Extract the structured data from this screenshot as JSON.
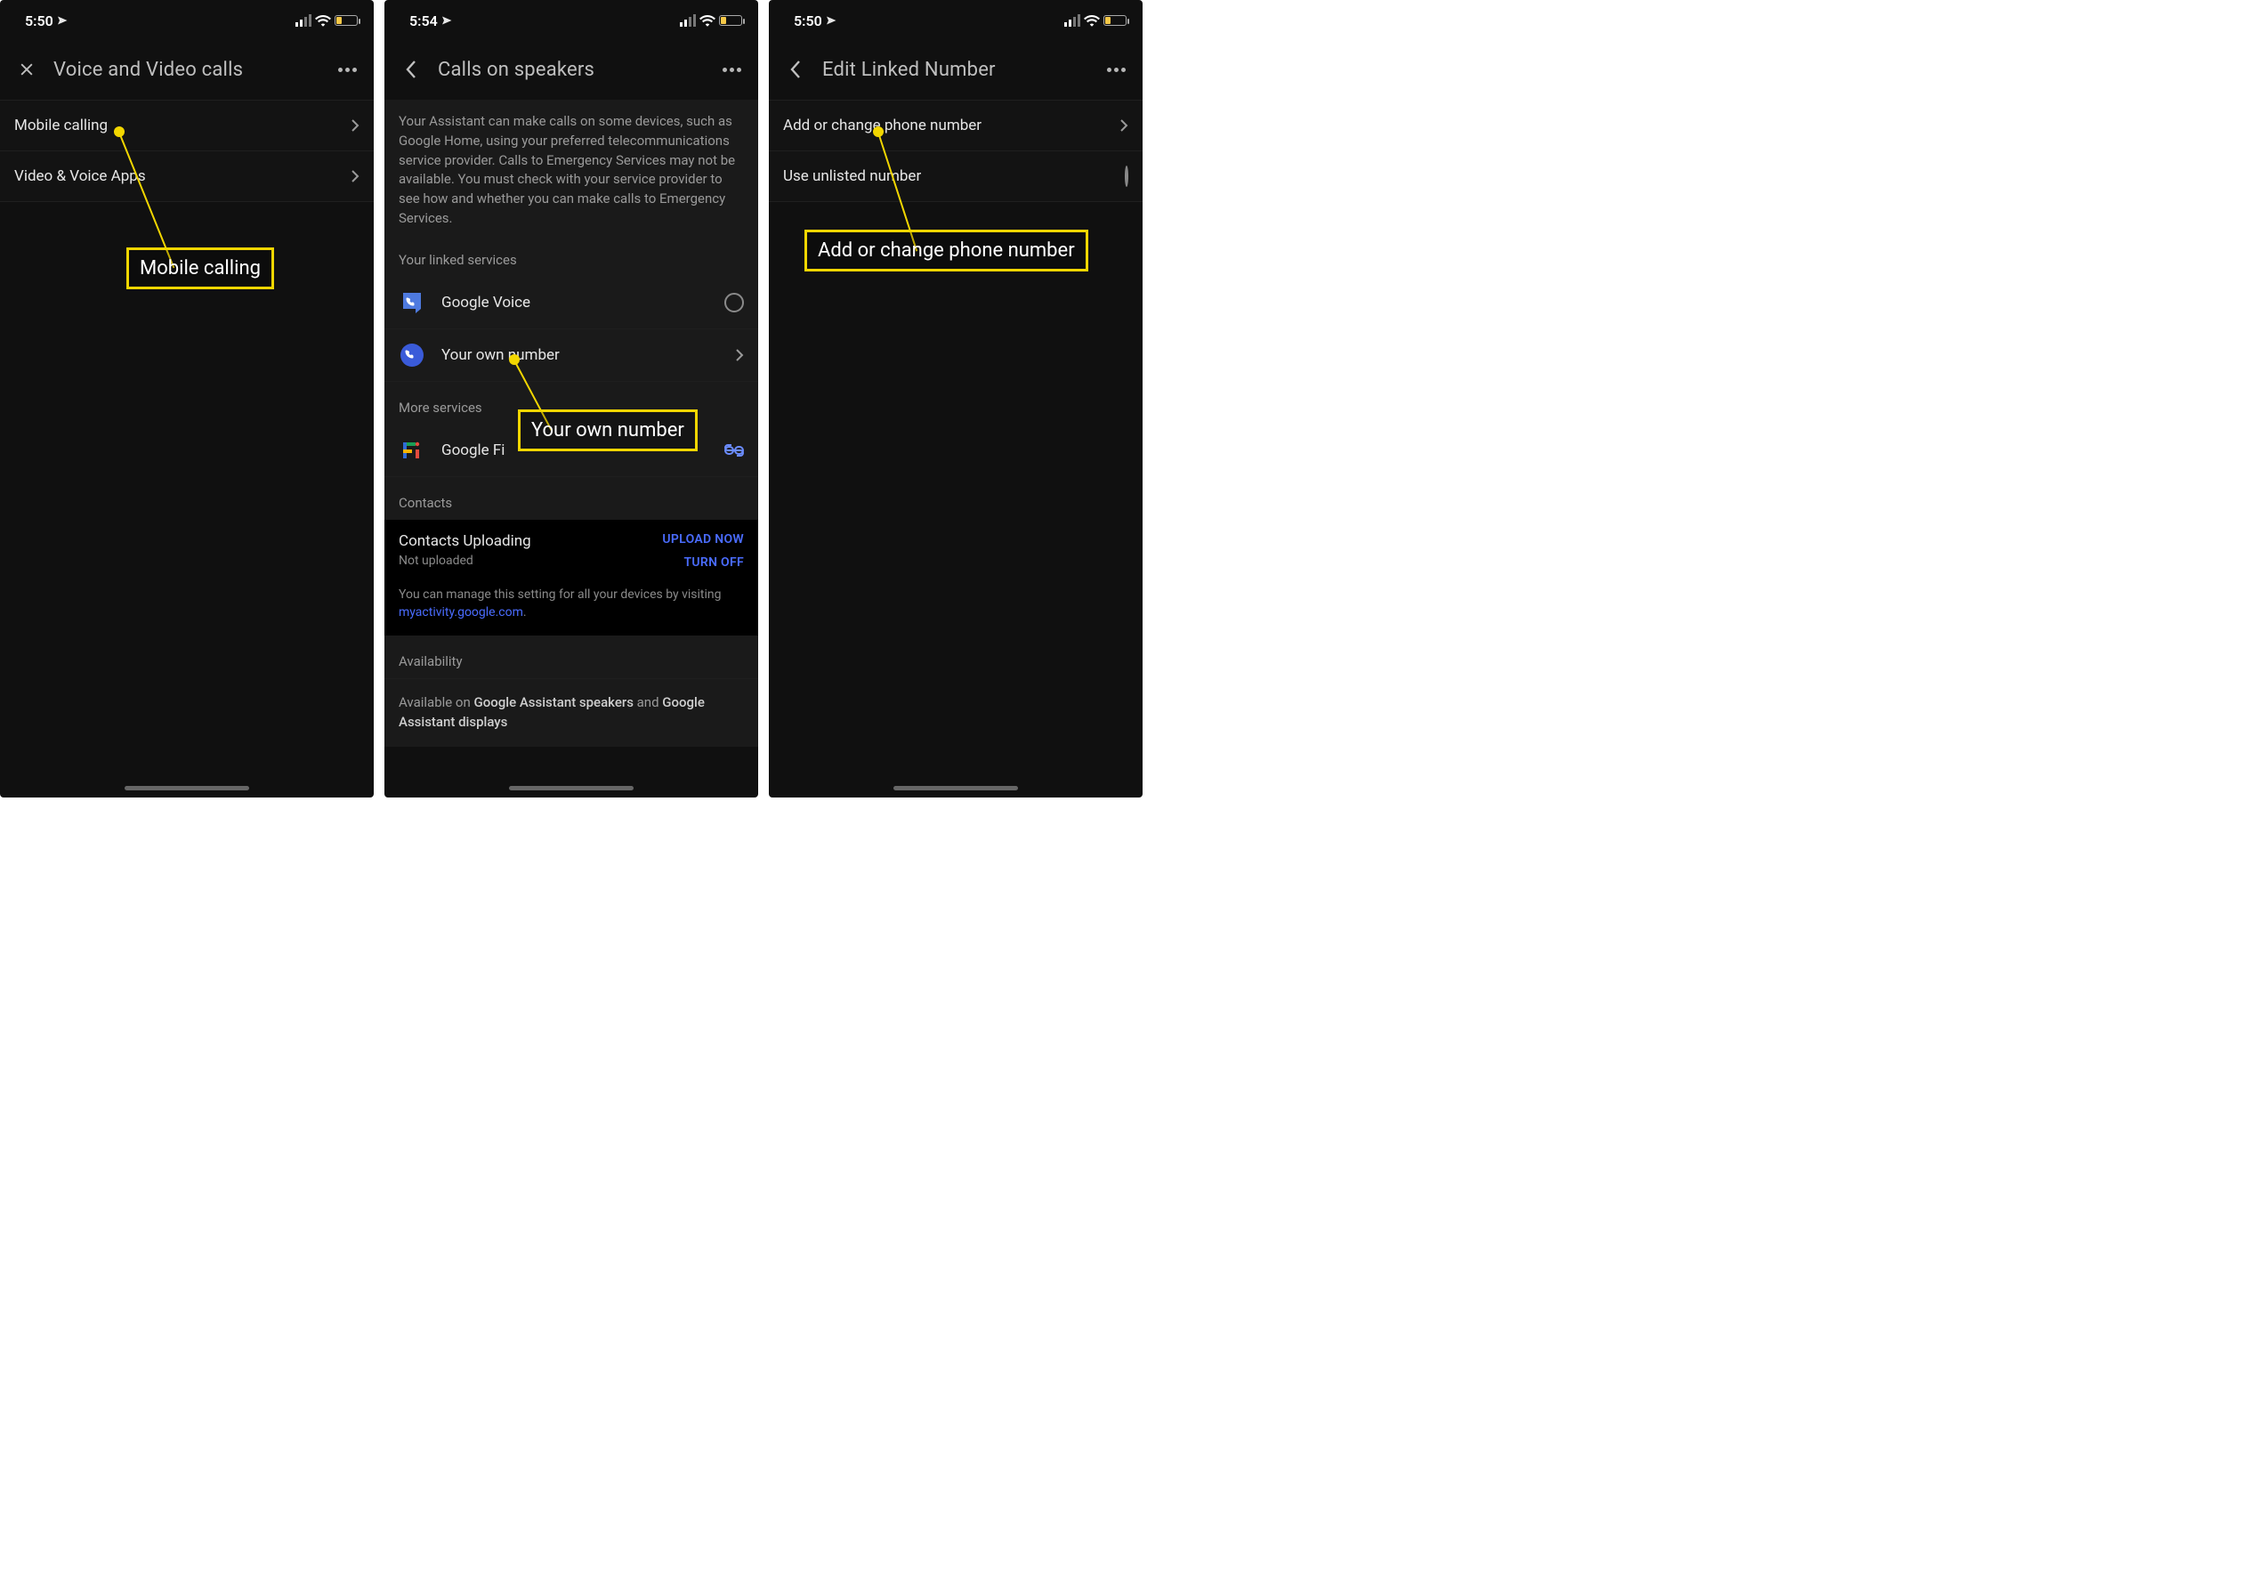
{
  "status": {
    "time1": "5:50",
    "time2": "5:54",
    "time3": "5:50"
  },
  "screen1": {
    "title": "Voice and Video calls",
    "row1": "Mobile calling",
    "row2": "Video & Voice Apps",
    "callout": "Mobile calling"
  },
  "screen2": {
    "title": "Calls on speakers",
    "intro": "Your Assistant can make calls on some devices, such as Google Home, using your preferred telecommunications service provider. Calls to Emergency Services may not be available. You must check with your service provider to see how and whether you can make calls to Emergency Services.",
    "linked_label": "Your linked services",
    "svc1": "Google Voice",
    "svc2": "Your own number",
    "more_label": "More services",
    "svc3": "Google Fi",
    "contacts_label": "Contacts",
    "contacts_title": "Contacts Uploading",
    "contacts_sub": "Not uploaded",
    "upload_now": "UPLOAD NOW",
    "turn_off": "TURN OFF",
    "contacts_note_pre": "You can manage this setting for all your devices by visiting ",
    "contacts_note_link": "myactivity.google.com",
    "availability_label": "Availability",
    "availability_text_pre": "Available on ",
    "availability_text_b1": "Google Assistant speakers",
    "availability_text_mid": " and ",
    "availability_text_b2": "Google Assistant displays",
    "callout": "Your own number"
  },
  "screen3": {
    "title": "Edit Linked Number",
    "row1": "Add or change phone number",
    "row2": "Use unlisted number",
    "callout": "Add or change phone number"
  }
}
